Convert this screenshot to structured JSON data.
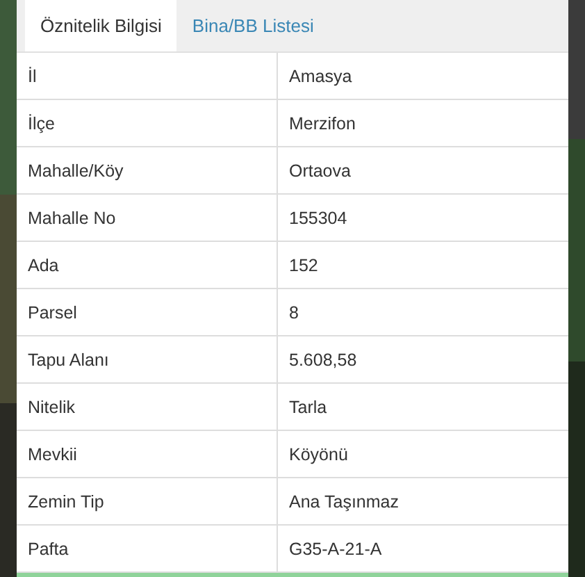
{
  "tabs": [
    {
      "label": "Öznitelik Bilgisi",
      "selected": true
    },
    {
      "label": "Bina/BB Listesi",
      "selected": false
    }
  ],
  "table": {
    "rows": [
      {
        "label": "İl",
        "value": "Amasya"
      },
      {
        "label": "İlçe",
        "value": "Merzifon"
      },
      {
        "label": "Mahalle/Köy",
        "value": "Ortaova"
      },
      {
        "label": "Mahalle No",
        "value": "155304"
      },
      {
        "label": "Ada",
        "value": "152"
      },
      {
        "label": "Parsel",
        "value": "8"
      },
      {
        "label": "Tapu Alanı",
        "value": "5.608,58"
      },
      {
        "label": "Nitelik",
        "value": "Tarla"
      },
      {
        "label": "Mevkii",
        "value": "Köyönü"
      },
      {
        "label": "Zemin Tip",
        "value": "Ana Taşınmaz"
      },
      {
        "label": "Pafta",
        "value": "G35-A-21-A"
      }
    ]
  }
}
